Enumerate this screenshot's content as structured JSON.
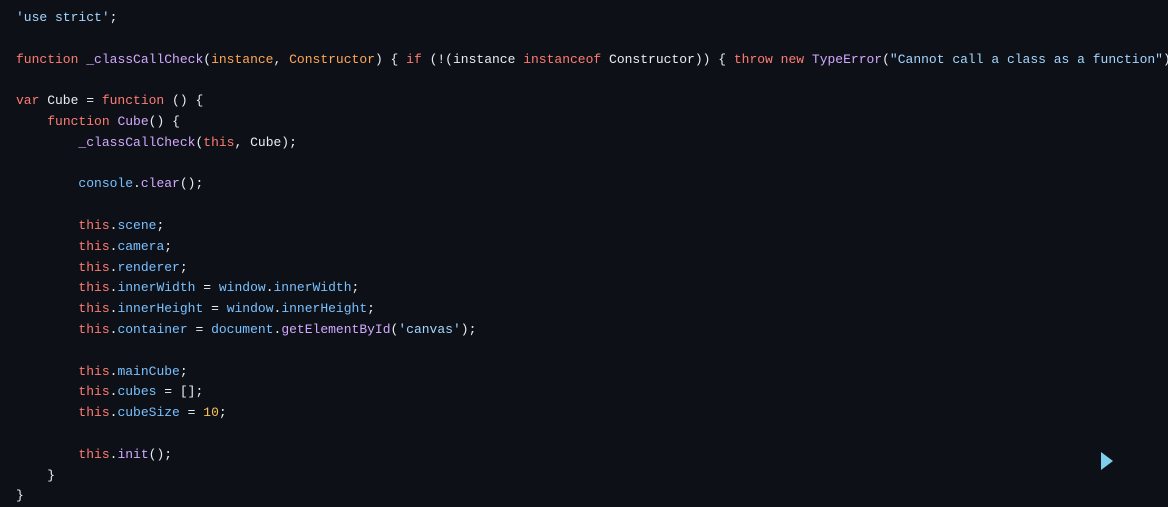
{
  "code": {
    "lines": [
      "'use strict';",
      "",
      "function _classCallCheck(instance, Constructor) { if (!(instance instanceof Constructor)) { throw new TypeError(\"Cannot call a class as a function\"); } }",
      "",
      "var Cube = function () {",
      "    function Cube() {",
      "        _classCallCheck(this, Cube);",
      "",
      "        console.clear();",
      "",
      "        this.scene;",
      "        this.camera;",
      "        this.renderer;",
      "        this.innerWidth = window.innerWidth;",
      "        this.innerHeight = window.innerHeight;",
      "        this.container = document.getElementById('canvas');",
      "",
      "        this.mainCube;",
      "        this.cubes = [];",
      "        this.cubeSize = 10;",
      "",
      "        this.init();",
      "    }",
      "}"
    ]
  }
}
